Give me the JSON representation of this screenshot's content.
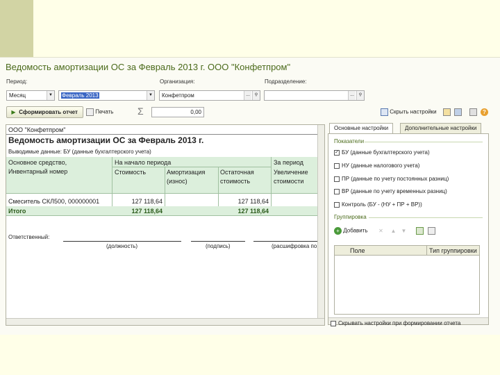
{
  "title": "Ведомость амортизации ОС за Февраль 2013 г. ООО \"Конфетпром\"",
  "filters": {
    "period_label": "Период:",
    "period_type": "Месяц",
    "period_value": "Февраль 2013",
    "org_label": "Организация:",
    "org_value": "Конфетпром",
    "dept_label": "Подразделение:",
    "dept_value": ""
  },
  "toolbar": {
    "generate": "Сформировать отчет",
    "print": "Печать",
    "sigma": "Σ",
    "sum_value": "0,00",
    "hide_settings": "Скрыть настройки"
  },
  "report": {
    "company": "ООО \"Конфетпром\"",
    "heading": "Ведомость амортизации ОС за Февраль 2013 г.",
    "output_data": "Выводимые данные:  БУ (данные бухгалтерского учета)",
    "col_asset_1": "Основное средство,",
    "col_asset_2": "Инвентарный номер",
    "col_start_period": "На начало периода",
    "col_cost": "Стоимость",
    "col_amort_1": "Амортизация",
    "col_amort_2": "(износ)",
    "col_residual_1": "Остаточная",
    "col_residual_2": "стоимость",
    "col_for_period": "За период",
    "col_increase_1": "Увеличение",
    "col_increase_2": "стоимости",
    "row_name": "Смеситель СКЛ500, 000000001",
    "row_cost": "127 118,64",
    "row_residual": "127 118,64",
    "total_label": "Итого",
    "total_cost": "127 118,64",
    "total_residual": "127 118,64",
    "responsible": "Ответственный:",
    "sig_position": "(должность)",
    "sig_signature": "(подпись)",
    "sig_decoding": "(расшифровка по"
  },
  "settings": {
    "tab_main": "Основные настройки",
    "tab_extra": "Дополнительные настройки",
    "indicators_title": "Показатели",
    "indicators": [
      {
        "label": "БУ (данные бухгалтерского учета)",
        "checked": true
      },
      {
        "label": "НУ (данные налогового учета)",
        "checked": false
      },
      {
        "label": "ПР (данные по учету постоянных разниц)",
        "checked": false
      },
      {
        "label": "ВР (данные по учету временных разниц)",
        "checked": false
      },
      {
        "label": "Контроль (БУ - (НУ + ПР + ВР))",
        "checked": false
      }
    ],
    "grouping_title": "Группировка",
    "add_button": "Добавить",
    "grid_col_field": "Поле",
    "grid_col_type": "Тип группировки",
    "hide_on_generate": "Скрывать настройки при формировании отчета"
  },
  "colors": {
    "title": "#4a6a1a",
    "header_band": "#dcefdc",
    "selection": "#3a66c4"
  }
}
